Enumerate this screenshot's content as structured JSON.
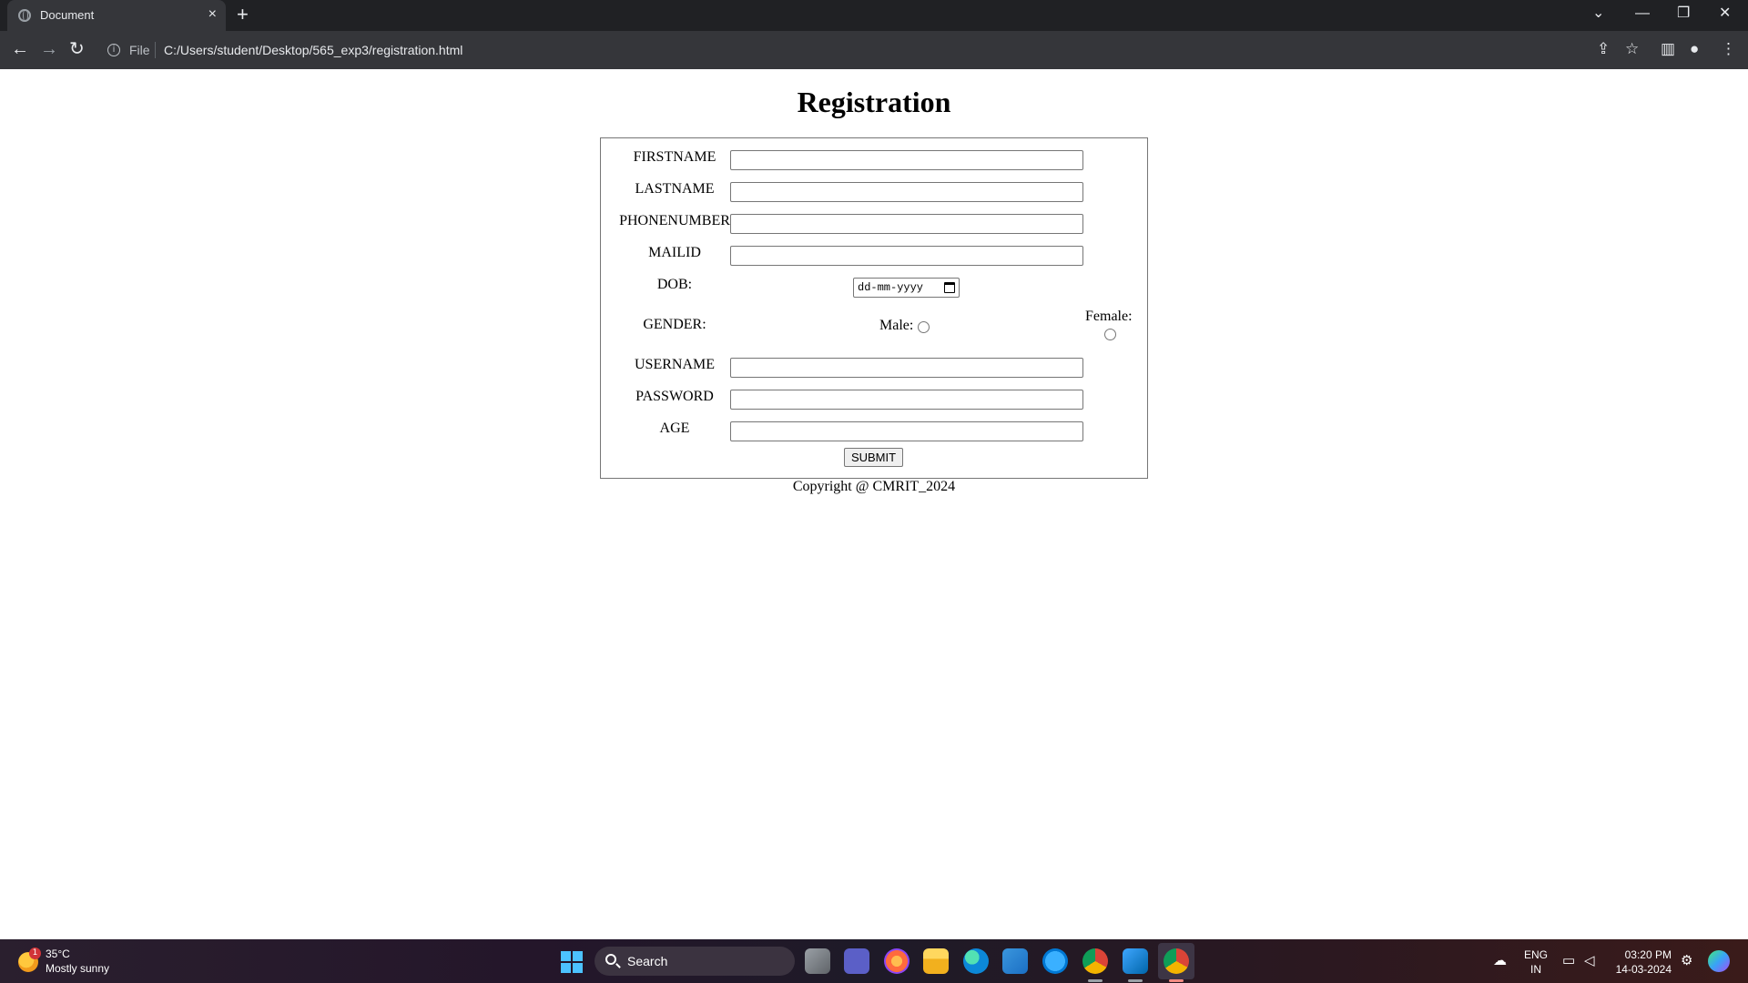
{
  "browser": {
    "tab_title": "Document",
    "tab_close": "×",
    "new_tab": "+",
    "window_controls": {
      "dropdown": "⌄",
      "minimize": "—",
      "restore": "❐",
      "close": "✕"
    },
    "nav": {
      "back": "←",
      "forward": "→",
      "reload": "↻"
    },
    "address": {
      "scheme": "File",
      "url": "C:/Users/student/Desktop/565_exp3/registration.html"
    },
    "toolbar_icons": {
      "share": "⇪",
      "bookmark": "☆",
      "side_panel": "▥",
      "profile": "●",
      "menu": "⋮"
    }
  },
  "page": {
    "heading": "Registration",
    "fields": {
      "firstname_label": "FIRSTNAME",
      "lastname_label": "LASTNAME",
      "phonenumber_label": "PHONENUMBER",
      "mailid_label": "MAILID",
      "dob_label": "DOB:",
      "dob_placeholder": "dd-mm-yyyy",
      "gender_label": "GENDER:",
      "male_label": "Male:",
      "female_label": "Female:",
      "username_label": "USERNAME",
      "password_label": "PASSWORD",
      "age_label": "AGE"
    },
    "submit_label": "SUBMIT",
    "copyright": "Copyright @ CMRIT_2024"
  },
  "taskbar": {
    "weather": {
      "temp": "35°C",
      "condition": "Mostly sunny",
      "badge": "1"
    },
    "search_label": "Search",
    "apps": [
      "task-view",
      "teams",
      "firefox",
      "file-explorer",
      "edge",
      "store",
      "help",
      "chrome",
      "vscode",
      "chrome-active"
    ],
    "tray": {
      "lang_top": "ENG",
      "lang_bottom": "IN",
      "time": "03:20 PM",
      "date": "14-03-2024"
    }
  }
}
